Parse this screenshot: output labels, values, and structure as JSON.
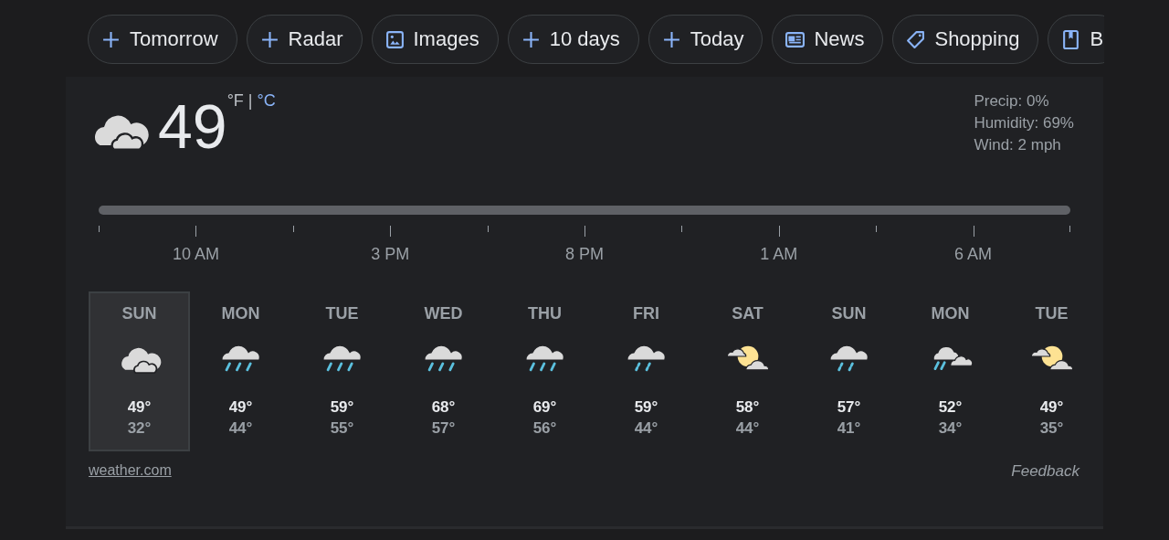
{
  "chips": [
    {
      "kind": "plus",
      "label": "Tomorrow"
    },
    {
      "kind": "plus",
      "label": "Radar"
    },
    {
      "kind": "image",
      "label": "Images"
    },
    {
      "kind": "plus",
      "label": "10 days"
    },
    {
      "kind": "plus",
      "label": "Today"
    },
    {
      "kind": "news",
      "label": "News"
    },
    {
      "kind": "tag",
      "label": "Shopping"
    },
    {
      "kind": "book",
      "label": "B"
    }
  ],
  "current": {
    "kind": "cloudy",
    "temperature": "49",
    "units": [
      {
        "label": "°F",
        "selected": true
      },
      {
        "label": "°C",
        "selected": false
      }
    ],
    "separator": "|",
    "details": [
      "Precip: 0%",
      "Humidity: 69%",
      "Wind: 2 mph"
    ]
  },
  "timeline": {
    "labels": [
      "10 AM",
      "3 PM",
      "8 PM",
      "1 AM",
      "6 AM"
    ]
  },
  "days": [
    {
      "day": "SUN",
      "kind": "cloudy",
      "high": "49°",
      "low": "32°",
      "selected": true
    },
    {
      "day": "MON",
      "kind": "rain",
      "high": "49°",
      "low": "44°",
      "selected": false
    },
    {
      "day": "TUE",
      "kind": "rain",
      "high": "59°",
      "low": "55°",
      "selected": false
    },
    {
      "day": "WED",
      "kind": "rain",
      "high": "68°",
      "low": "57°",
      "selected": false
    },
    {
      "day": "THU",
      "kind": "rain",
      "high": "69°",
      "low": "56°",
      "selected": false
    },
    {
      "day": "FRI",
      "kind": "showers",
      "high": "59°",
      "low": "44°",
      "selected": false
    },
    {
      "day": "SAT",
      "kind": "sunny",
      "high": "58°",
      "low": "44°",
      "selected": false
    },
    {
      "day": "SUN",
      "kind": "showers",
      "high": "57°",
      "low": "41°",
      "selected": false
    },
    {
      "day": "MON",
      "kind": "mixed",
      "high": "52°",
      "low": "34°",
      "selected": false
    },
    {
      "day": "TUE",
      "kind": "sunny",
      "high": "49°",
      "low": "35°",
      "selected": false
    }
  ],
  "source": "weather.com",
  "feedback": "Feedback"
}
